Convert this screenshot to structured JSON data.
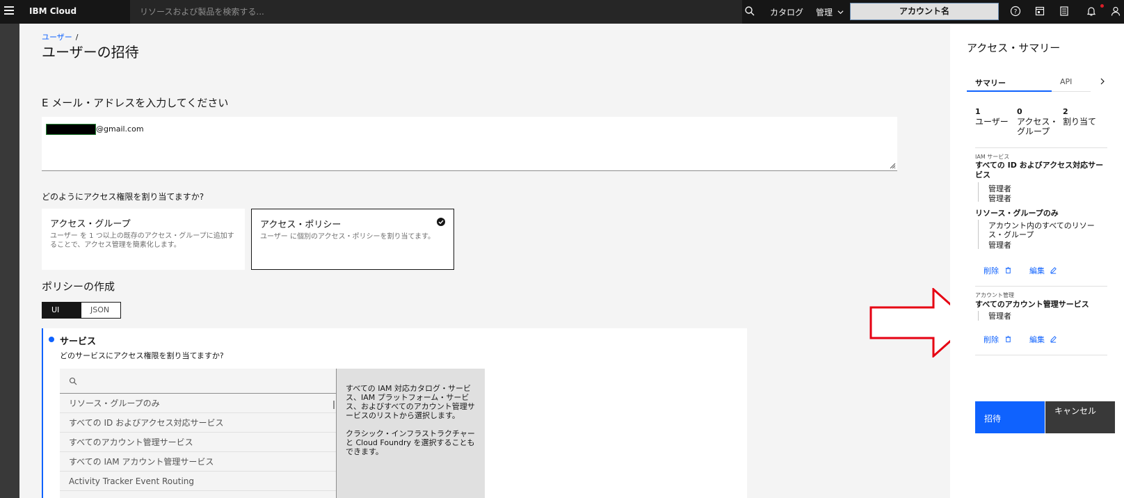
{
  "header": {
    "brand": "IBM Cloud",
    "search_placeholder": "リソースおよび製品を検索する...",
    "catalog": "カタログ",
    "manage": "管理",
    "account": "アカウント名"
  },
  "breadcrumb": {
    "users": "ユーザー",
    "sep": "/"
  },
  "page_title": "ユーザーの招待",
  "email": {
    "heading": "E メール・アドレスを入力してください",
    "value_suffix": "@gmail.com"
  },
  "assign_question": "どのようにアクセス権限を割り当てますか?",
  "tiles": {
    "group_title": "アクセス・グループ",
    "group_desc": "ユーザー を 1 つ以上の既存のアクセス・グループに追加することで、アクセス管理を簡素化します。",
    "policy_title": "アクセス・ポリシー",
    "policy_desc": "ユーザー に個別のアクセス・ポリシーを割り当てます。"
  },
  "policy": {
    "heading": "ポリシーの作成",
    "ui": "UI",
    "json": "JSON"
  },
  "service": {
    "title": "サービス",
    "question": "どのサービスにアクセス権限を割り当てますか?",
    "items": [
      "リソース・グループのみ",
      "すべての ID およびアクセス対応サービス",
      "すべてのアカウント管理サービス",
      "すべての IAM アカウント管理サービス",
      "Activity Tracker Event Routing"
    ],
    "desc1": "すべての IAM 対応カタログ・サービス、IAM プラットフォーム・サービス、およびすべてのアカウント管理サービスのリストから選択します。",
    "desc2": "クラシック・インフラストラクチャーと Cloud Foundry を選択することもできます。"
  },
  "summary": {
    "title": "アクセス・サマリー",
    "tab_summary": "サマリー",
    "tab_api": "API",
    "stats": [
      {
        "num": "1",
        "label": "ユーザー"
      },
      {
        "num": "0",
        "label": "アクセス・グループ"
      },
      {
        "num": "2",
        "label": "割り当て"
      }
    ],
    "iam_label": "IAM サービス",
    "iam_title": "すべての ID およびアクセス対応サービス",
    "iam_role1": "管理者",
    "iam_role2": "管理者",
    "rg_title": "リソース・グループのみ",
    "rg_item": "アカウント内のすべてのリソース・グループ",
    "rg_role": "管理者",
    "delete": "削除",
    "edit": "編集",
    "acct_label": "アカウント管理",
    "acct_title": "すべてのアカウント管理サービス",
    "acct_role": "管理者",
    "invite": "招待",
    "cancel": "キャンセル"
  },
  "colors": {
    "accent": "#0f62fe",
    "header_bg": "#161616",
    "annotation_arrow": "#e60012"
  }
}
